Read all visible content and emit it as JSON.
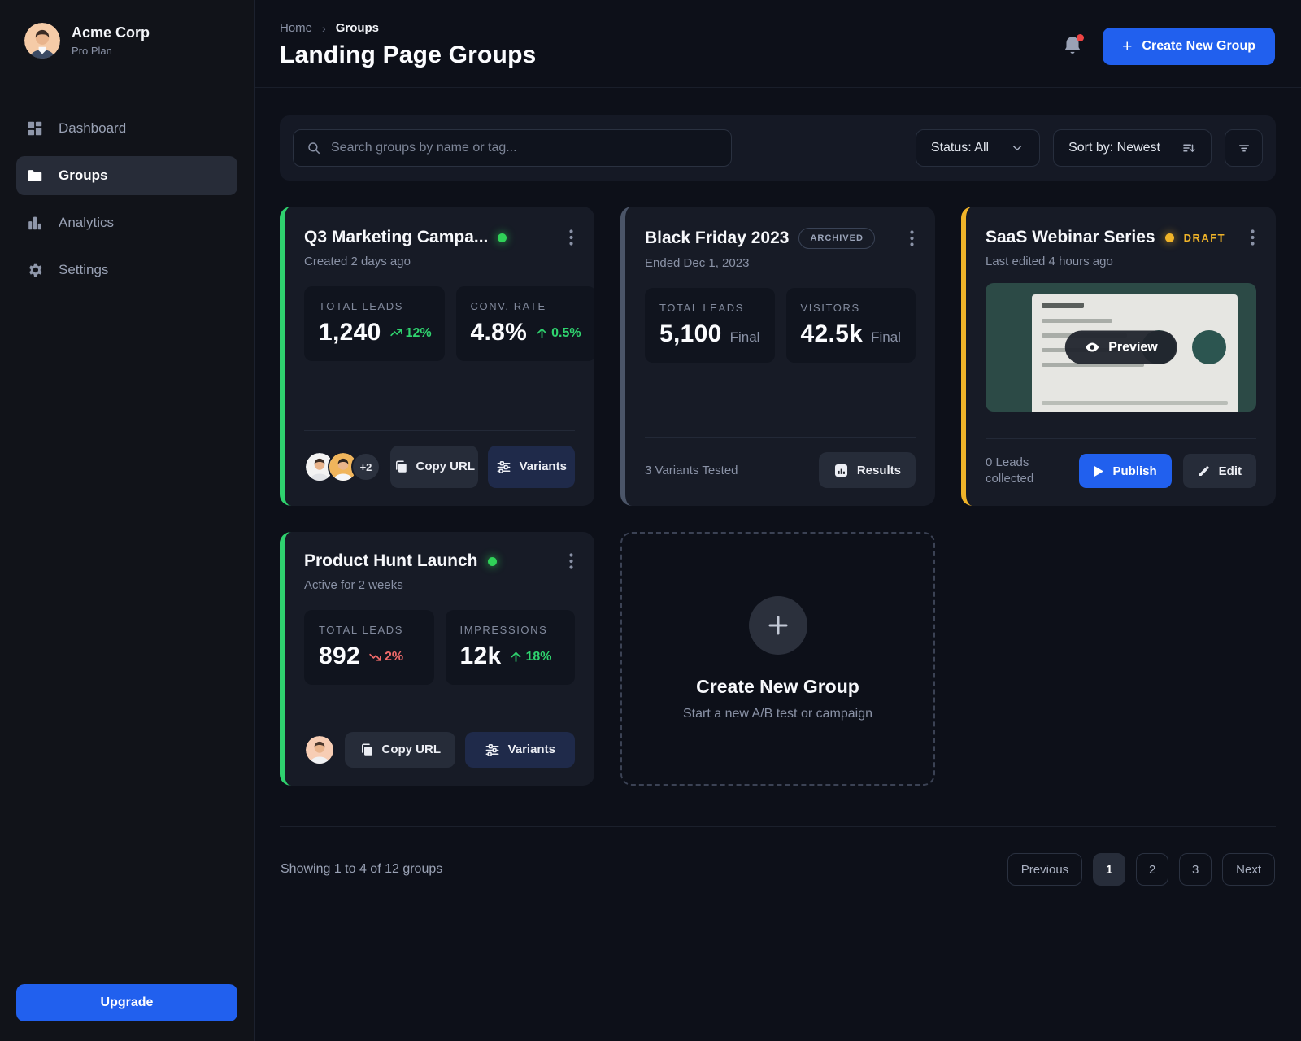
{
  "sidebar": {
    "org": {
      "name": "Acme Corp",
      "plan": "Pro Plan"
    },
    "nav": [
      {
        "label": "Dashboard",
        "icon": "dashboard-grid-icon",
        "active": false
      },
      {
        "label": "Groups",
        "icon": "folder-icon",
        "active": true
      },
      {
        "label": "Analytics",
        "icon": "bar-chart-icon",
        "active": false
      },
      {
        "label": "Settings",
        "icon": "gear-icon",
        "active": false
      }
    ],
    "upgrade_label": "Upgrade"
  },
  "header": {
    "breadcrumb": {
      "home": "Home",
      "current": "Groups",
      "separator": "›"
    },
    "title": "Landing Page Groups",
    "create_button": "Create New Group",
    "plus": "+"
  },
  "toolbar": {
    "search_placeholder": "Search groups by name or tag...",
    "status_label": "Status: All",
    "sort_label": "Sort by: Newest"
  },
  "cards": [
    {
      "name": "Q3 Marketing Campa...",
      "status": "active",
      "subtitle": "Created 2 days ago",
      "stats": [
        {
          "label": "TOTAL LEADS",
          "value": "1,240",
          "trend": "12%",
          "trend_dir": "up"
        },
        {
          "label": "CONV. RATE",
          "value": "4.8%",
          "trend": "0.5%",
          "trend_dir": "up"
        }
      ],
      "extra_avatars": "+2",
      "copy_label": "Copy URL",
      "variants_label": "Variants"
    },
    {
      "name": "Black Friday 2023",
      "badge": "ARCHIVED",
      "subtitle": "Ended Dec 1, 2023",
      "stats": [
        {
          "label": "TOTAL LEADS",
          "value": "5,100",
          "suffix": "Final"
        },
        {
          "label": "VISITORS",
          "value": "42.5k",
          "suffix": "Final"
        }
      ],
      "note": "3 Variants Tested",
      "results_label": "Results"
    },
    {
      "name": "SaaS Webinar Series",
      "status": "draft",
      "badge": "DRAFT",
      "subtitle": "Last edited 4 hours ago",
      "preview_label": "Preview",
      "note": "0 Leads collected",
      "publish_label": "Publish",
      "edit_label": "Edit"
    },
    {
      "name": "Product Hunt Launch",
      "status": "active",
      "subtitle": "Active for 2 weeks",
      "stats": [
        {
          "label": "TOTAL LEADS",
          "value": "892",
          "trend": "2%",
          "trend_dir": "down"
        },
        {
          "label": "IMPRESSIONS",
          "value": "12k",
          "trend": "18%",
          "trend_dir": "up"
        }
      ],
      "copy_label": "Copy URL",
      "variants_label": "Variants"
    }
  ],
  "create_card": {
    "title": "Create New Group",
    "subtitle": "Start a new A/B test or campaign"
  },
  "footer": {
    "showing": "Showing 1 to 4 of 12 groups",
    "previous": "Previous",
    "pages": [
      "1",
      "2",
      "3"
    ],
    "active_page": "1",
    "next": "Next"
  },
  "colors": {
    "accent_blue": "#2160ee",
    "green": "#2fd26e",
    "amber": "#f0b429",
    "red": "#f16a6a",
    "archived_gray": "#9aa3b8"
  }
}
